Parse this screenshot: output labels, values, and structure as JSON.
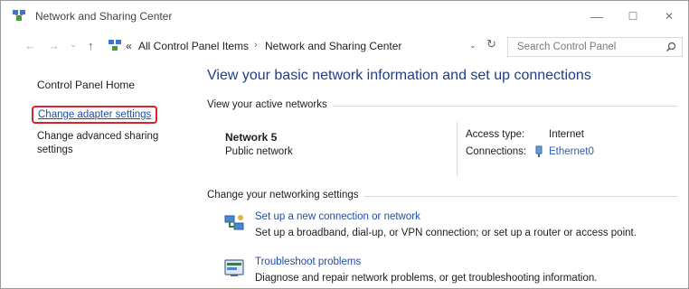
{
  "window": {
    "title": "Network and Sharing Center",
    "controls": {
      "minimize": "—",
      "maximize": "☐",
      "close": "✕"
    }
  },
  "address_bar": {
    "back_icon": "←",
    "forward_icon": "→",
    "history_icon": "⌄",
    "up_icon": "↑",
    "overflow": "«",
    "crumbs": [
      "All Control Panel Items",
      "Network and Sharing Center"
    ],
    "separator": "›",
    "dropdown_icon": "⌄",
    "refresh_icon": "↻",
    "search_placeholder": "Search Control Panel"
  },
  "sidebar": {
    "home": "Control Panel Home",
    "items": [
      {
        "label": "Change adapter settings",
        "highlighted": true
      },
      {
        "label": "Change advanced sharing settings"
      }
    ]
  },
  "main": {
    "heading": "View your basic network information and set up connections",
    "active_networks_label": "View your active networks",
    "network": {
      "name": "Network  5",
      "category": "Public network",
      "access_type_label": "Access type:",
      "access_type_value": "Internet",
      "connections_label": "Connections:",
      "connections_value": "Ethernet0"
    },
    "change_settings_label": "Change your networking settings",
    "tasks": [
      {
        "icon": "network-setup-icon",
        "title": "Set up a new connection or network",
        "description": "Set up a broadband, dial-up, or VPN connection; or set up a router or access point."
      },
      {
        "icon": "troubleshoot-icon",
        "title": "Troubleshoot problems",
        "description": "Diagnose and repair network problems, or get troubleshooting information."
      }
    ]
  },
  "colors": {
    "link": "#1f4ea8",
    "heading": "#1e3e8a",
    "highlight_border": "#d9252a"
  }
}
